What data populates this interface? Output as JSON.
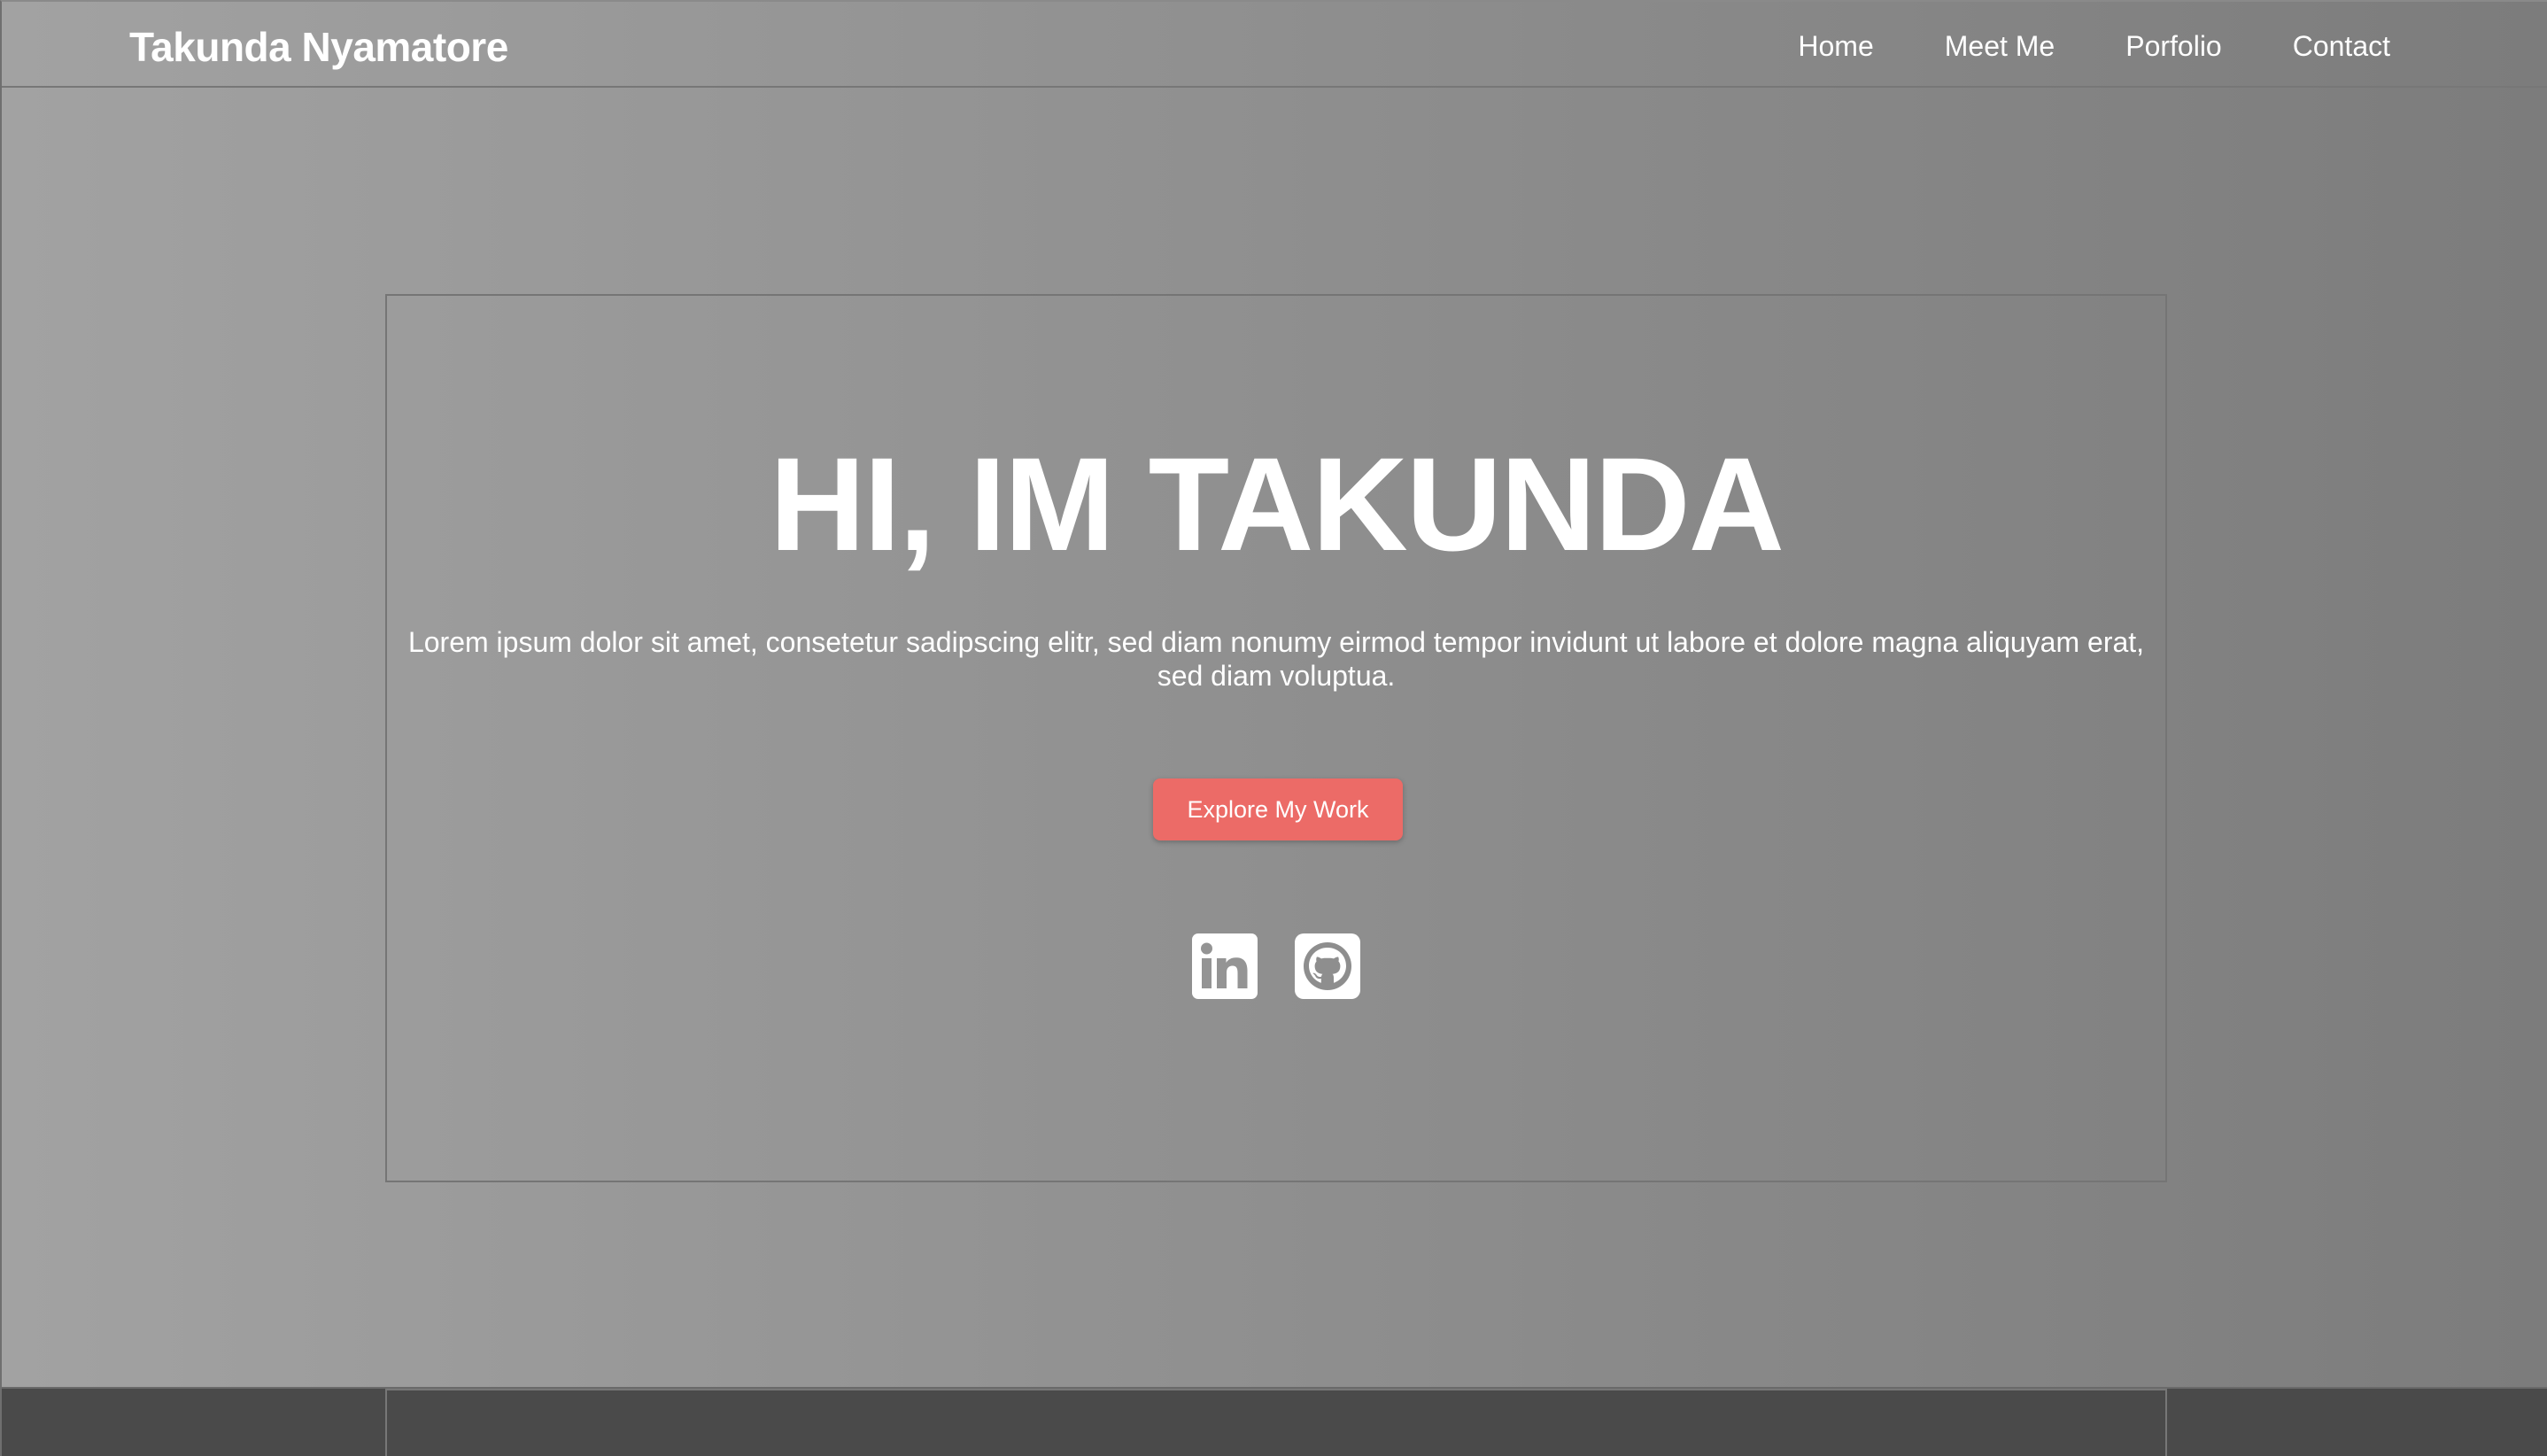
{
  "header": {
    "brand": "Takunda Nyamatore",
    "nav": [
      {
        "label": "Home"
      },
      {
        "label": "Meet Me"
      },
      {
        "label": "Porfolio"
      },
      {
        "label": "Contact"
      }
    ]
  },
  "hero": {
    "title": "HI, IM TAKUNDA",
    "text_line1": "Lorem ipsum dolor sit amet, consetetur sadipscing elitr, sed diam nonumy eirmod tempor invidunt ut labore et dolore magna aliquyam erat,",
    "text_line2": "sed diam voluptua.",
    "button_label": "Explore My Work",
    "social": [
      {
        "icon": "linkedin-icon"
      },
      {
        "icon": "github-icon"
      }
    ]
  },
  "colors": {
    "accent": "#ec6b67",
    "text": "#ffffff",
    "footer": "#4a4a4a"
  }
}
